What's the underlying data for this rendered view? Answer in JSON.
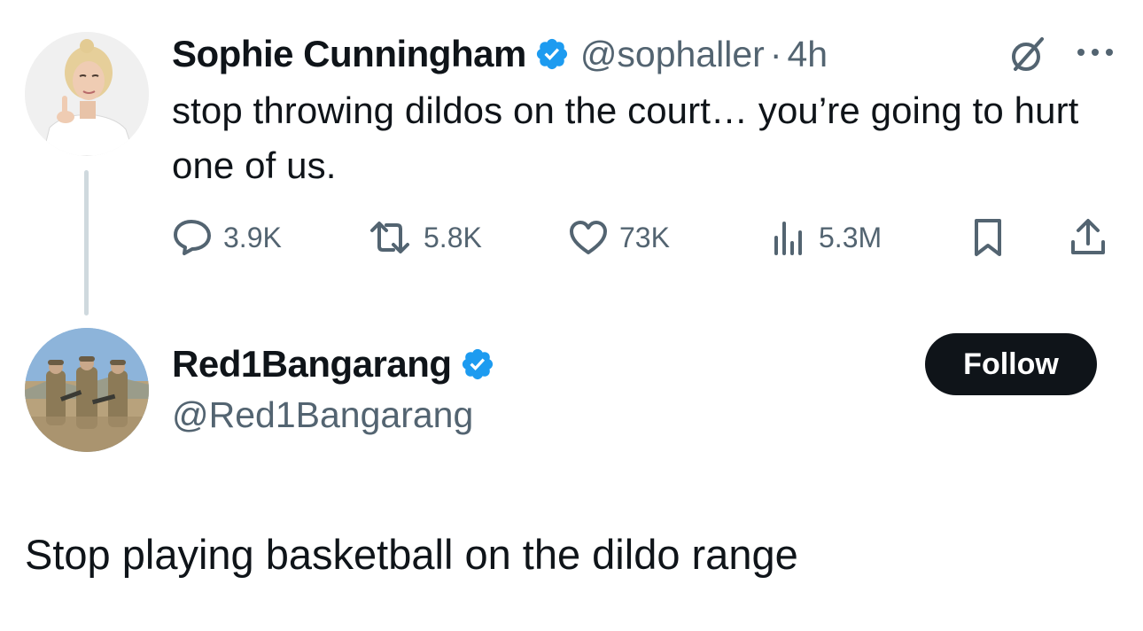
{
  "parent_tweet": {
    "display_name": "Sophie Cunningham",
    "handle": "@sophaller",
    "separator": "·",
    "time": "4h",
    "text": "stop throwing dildos on the court… you’re going to hurt one of us.",
    "actions": {
      "replies": "3.9K",
      "retweets": "5.8K",
      "likes": "73K",
      "views": "5.3M"
    },
    "icons": [
      "verified-badge-icon",
      "grok-icon",
      "more-icon",
      "reply-icon",
      "retweet-icon",
      "like-icon",
      "views-icon",
      "bookmark-icon",
      "share-icon"
    ]
  },
  "reply": {
    "display_name": "Red1Bangarang",
    "handle": "@Red1Bangarang",
    "follow_label": "Follow",
    "text": "Stop playing basketball on the dildo range"
  },
  "colors": {
    "text_primary": "#0f1419",
    "text_secondary": "#536471",
    "verified_blue": "#1d9bf0",
    "thread_line": "#cfd9de",
    "follow_button": "#0f1419"
  }
}
